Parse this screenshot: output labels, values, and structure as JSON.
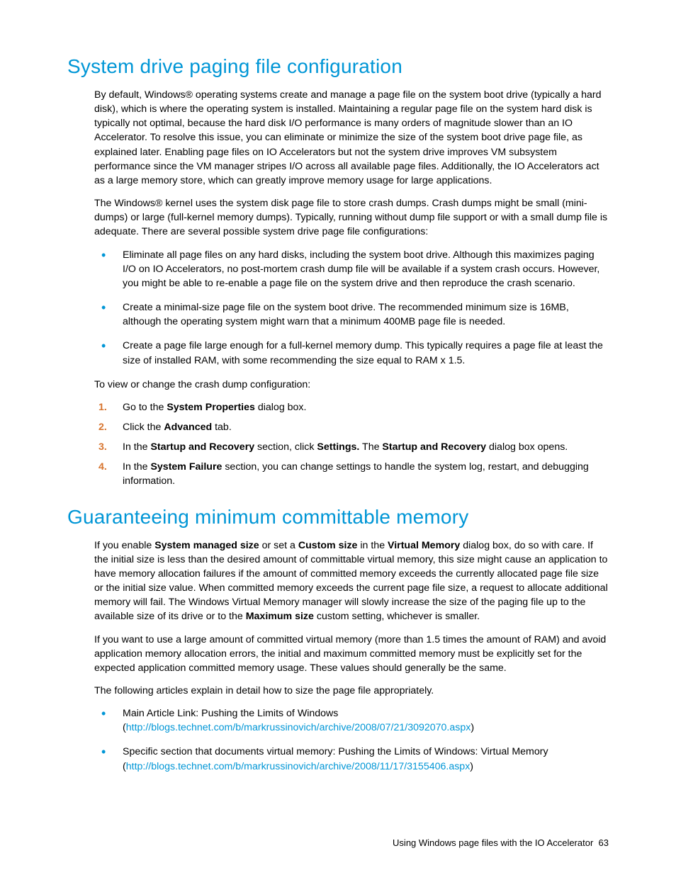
{
  "section1": {
    "heading": "System drive paging file configuration",
    "p1": "By default, Windows® operating systems create and manage a page file on the system boot drive (typically a hard disk), which is where the operating system is installed. Maintaining a regular page file on the system hard disk is typically not optimal, because the hard disk I/O performance is many orders of magnitude slower than an IO Accelerator. To resolve this issue, you can eliminate or minimize the size of the system boot drive page file, as explained later. Enabling page files on IO Accelerators but not the system drive improves VM subsystem performance since the VM manager stripes I/O across all available page files. Additionally, the IO Accelerators act as a large memory store, which can greatly improve memory usage for large applications.",
    "p2": "The Windows® kernel uses the system disk page file to store crash dumps. Crash dumps might be small (mini-dumps) or large (full-kernel memory dumps). Typically, running without dump file support or with a small dump file is adequate. There are several possible system drive page file configurations:",
    "bullets": [
      "Eliminate all page files on any hard disks, including the system boot drive. Although this maximizes paging I/O on IO Accelerators, no post-mortem crash dump file will be available if a system crash occurs. However, you might be able to re-enable a page file on the system drive and then reproduce the crash scenario.",
      "Create a minimal-size page file on the system boot drive. The recommended minimum size is 16MB, although the operating system might warn that a minimum 400MB page file is needed.",
      "Create a page file large enough for a full-kernel memory dump. This typically requires a page file at least the size of installed RAM, with some recommending the size equal to RAM x 1.5."
    ],
    "p3": "To view or change the crash dump configuration:",
    "steps": {
      "s1_a": "Go to the ",
      "s1_b": "System Properties",
      "s1_c": " dialog box.",
      "s2_a": "Click the ",
      "s2_b": "Advanced",
      "s2_c": " tab.",
      "s3_a": "In the ",
      "s3_b": "Startup and Recovery",
      "s3_c": " section, click ",
      "s3_d": "Settings.",
      "s3_e": " The ",
      "s3_f": "Startup and Recovery",
      "s3_g": " dialog box opens.",
      "s4_a": "In the ",
      "s4_b": "System Failure",
      "s4_c": " section, you can change settings to handle the system log, restart, and debugging information."
    }
  },
  "section2": {
    "heading": "Guaranteeing minimum committable memory",
    "p1_a": "If you enable ",
    "p1_b": "System managed size",
    "p1_c": " or set a ",
    "p1_d": "Custom size",
    "p1_e": " in the ",
    "p1_f": "Virtual Memory",
    "p1_g": " dialog box, do so with care. If the initial size is less than the desired amount of committable virtual memory, this size might cause an application to have memory allocation failures if the amount of committed memory exceeds the currently allocated page file size or the initial size value. When committed memory exceeds the current page file size, a request to allocate additional memory will fail. The Windows Virtual Memory manager will slowly increase the size of the paging file up to the available size of its drive or to the ",
    "p1_h": "Maximum size",
    "p1_i": " custom setting, whichever is smaller.",
    "p2": "If you want to use a large amount of committed virtual memory (more than 1.5 times the amount of RAM) and avoid application memory allocation errors, the initial and maximum committed memory must be explicitly set for the expected application committed memory usage. These values should generally be the same.",
    "p3": "The following articles explain in detail how to size the page file appropriately.",
    "bullets": {
      "b1_a": "Main Article Link: Pushing the Limits of Windows (",
      "b1_link": "http://blogs.technet.com/b/markrussinovich/archive/2008/07/21/3092070.aspx",
      "b1_c": ")",
      "b2_a": "Specific section that documents virtual memory: Pushing the Limits of Windows: Virtual Memory (",
      "b2_link": "http://blogs.technet.com/b/markrussinovich/archive/2008/11/17/3155406.aspx",
      "b2_c": ")"
    }
  },
  "footer": {
    "text": "Using Windows page files with the IO Accelerator",
    "page": "63"
  }
}
